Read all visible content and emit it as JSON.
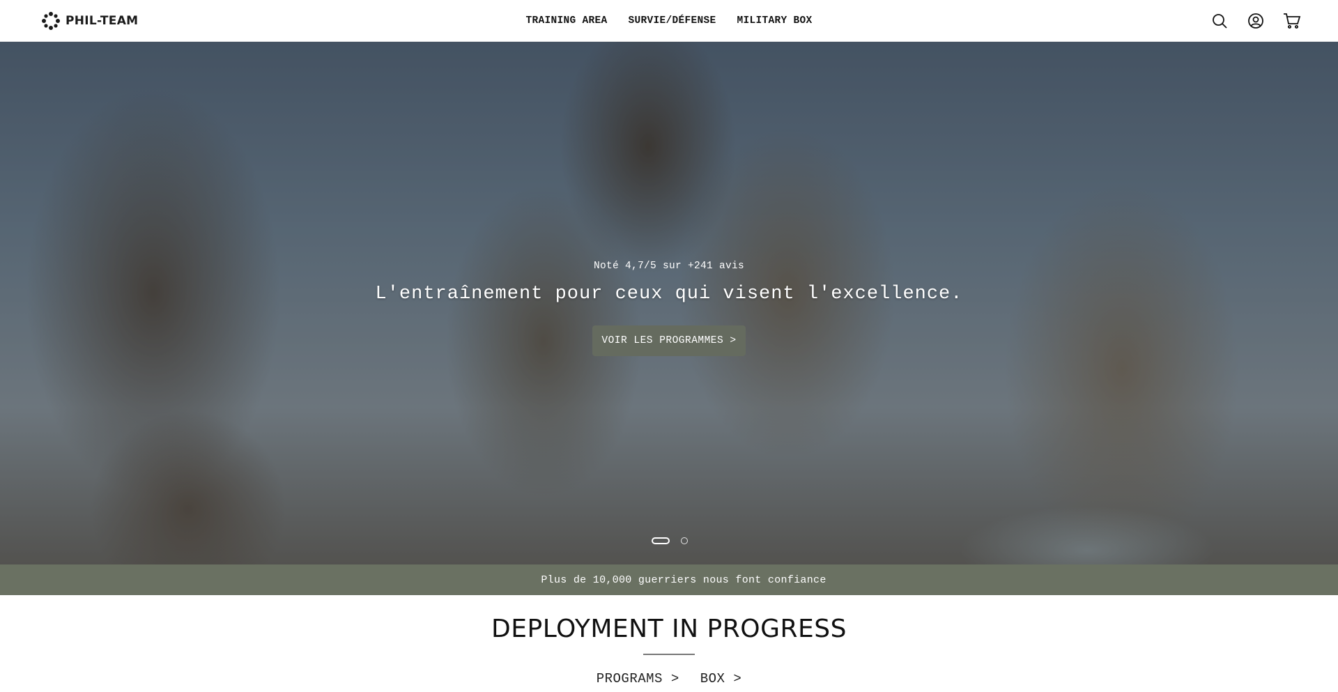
{
  "header": {
    "brand": "PHIL-TEAM",
    "nav": [
      {
        "label": "TRAINING AREA"
      },
      {
        "label": "SURVIE/DÉFENSE"
      },
      {
        "label": "MILITARY BOX"
      }
    ],
    "icons": [
      "search-icon",
      "account-icon",
      "cart-icon"
    ]
  },
  "hero": {
    "rating": "Noté 4,7/5 sur +241 avis",
    "title": "L'entraînement pour ceux qui visent l'excellence.",
    "cta": "VOIR LES PROGRAMMES >",
    "slides_total": 2,
    "active_slide": 1
  },
  "trust_bar": {
    "stars": [
      "",
      "",
      "",
      "",
      ""
    ],
    "text": "Plus de 10,000 guerriers nous font confiance"
  },
  "deployment": {
    "title": "DEPLOYMENT IN PROGRESS",
    "tabs": [
      {
        "label": "PROGRAMS >"
      },
      {
        "label": "BOX >"
      }
    ]
  },
  "colors": {
    "cta_bg": "#656b5f",
    "trust_bar_bg": "#6a7162",
    "header_bg": "#ffffff"
  }
}
